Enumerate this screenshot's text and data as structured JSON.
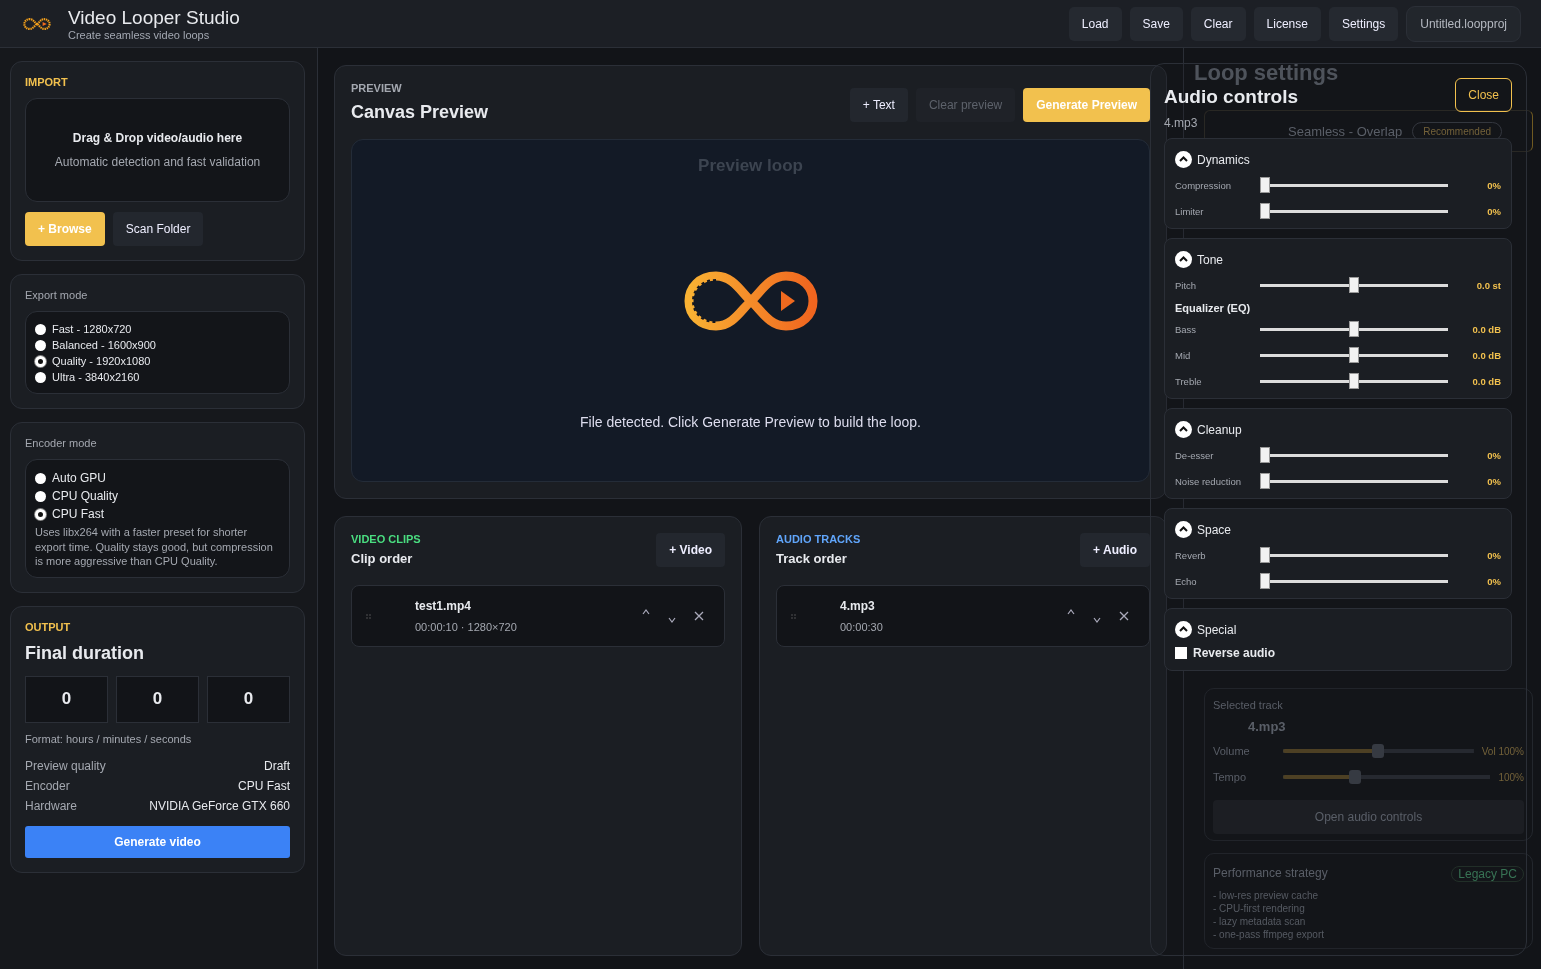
{
  "app": {
    "title": "Video Looper Studio",
    "subtitle": "Create seamless video loops"
  },
  "toolbar": [
    {
      "label": "Load"
    },
    {
      "label": "Save"
    },
    {
      "label": "Clear"
    },
    {
      "label": "License"
    },
    {
      "label": "Settings"
    }
  ],
  "project_file": "Untitled.loopproj",
  "import": {
    "heading": "IMPORT",
    "drop_title": "Drag & Drop video/audio here",
    "drop_hint": "Automatic detection and fast validation",
    "buttons": [
      {
        "label": "+ Browse",
        "kind": "primary"
      },
      {
        "label": "Scan Folder",
        "kind": "secondary"
      }
    ]
  },
  "export_mode": {
    "heading": "Export mode",
    "options": [
      {
        "label": "Fast - 1280x720",
        "selected": false
      },
      {
        "label": "Balanced - 1600x900",
        "selected": false
      },
      {
        "label": "Quality - 1920x1080",
        "selected": true
      },
      {
        "label": "Ultra - 3840x2160",
        "selected": false
      }
    ]
  },
  "encoder_mode": {
    "heading": "Encoder mode",
    "options": [
      {
        "label": "Auto GPU",
        "selected": false
      },
      {
        "label": "CPU Quality",
        "selected": false
      },
      {
        "label": "CPU Fast",
        "selected": true
      }
    ],
    "description": "Uses libx264 with a faster preset for shorter export time. Quality stays good, but compression is more aggressive than CPU Quality."
  },
  "output": {
    "heading": "OUTPUT",
    "title": "Final duration",
    "fields": [
      "0",
      "0",
      "0"
    ],
    "format_hint": "Format: hours / minutes / seconds",
    "info": [
      {
        "label": "Preview quality",
        "value": "Draft"
      },
      {
        "label": "Encoder",
        "value": "CPU Fast"
      },
      {
        "label": "Hardware",
        "value": "NVIDIA GeForce GTX 660"
      }
    ],
    "button": "Generate video"
  },
  "preview": {
    "eyebrow": "PREVIEW",
    "title": "Canvas Preview",
    "buttons": [
      {
        "label": "+ Text",
        "kind": "secondary"
      },
      {
        "label": "Clear preview",
        "kind": "disabled"
      },
      {
        "label": "Generate Preview",
        "kind": "primary"
      }
    ],
    "canvas_title": "Preview loop",
    "message": "File detected. Click Generate Preview to build the loop."
  },
  "video_clips": {
    "eyebrow": "VIDEO CLIPS",
    "title": "Clip order",
    "add_button": "+ Video",
    "items": [
      {
        "name": "test1.mp4",
        "meta": "00:00:10 · 1280×720"
      }
    ]
  },
  "audio_tracks": {
    "eyebrow": "AUDIO TRACKS",
    "title": "Track order",
    "add_button": "+ Audio",
    "items": [
      {
        "name": "4.mp3",
        "meta": "00:00:30"
      }
    ]
  },
  "loop_settings": {
    "title": "Loop settings",
    "option": {
      "label": "Seamless - Overlap",
      "badge": "Recommended"
    },
    "selected_track_label": "Selected track",
    "selected_track": "4.mp3",
    "sliders": [
      {
        "label": "Volume",
        "level": 0.5,
        "reading": "Vol 100%"
      },
      {
        "label": "Tempo",
        "level": 0.34,
        "reading": "100%"
      }
    ],
    "open_button": "Open audio controls",
    "performance": {
      "title": "Performance strategy",
      "badge": "Legacy PC",
      "items": [
        "- low-res preview cache",
        "- CPU-first rendering",
        "- lazy metadata scan",
        "- one-pass ffmpeg export"
      ]
    }
  },
  "audio_controls": {
    "title": "Audio controls",
    "close": "Close",
    "track": "4.mp3",
    "sections": [
      {
        "title": "Dynamics",
        "expanded": true,
        "rows": [
          {
            "kind": "slider",
            "label": "Compression",
            "level": 0,
            "reading": "0%"
          },
          {
            "kind": "slider",
            "label": "Limiter",
            "level": 0,
            "reading": "0%"
          }
        ]
      },
      {
        "title": "Tone",
        "expanded": true,
        "rows": [
          {
            "kind": "slider",
            "label": "Pitch",
            "level": 0.5,
            "reading": "0.0 st"
          },
          {
            "kind": "subheading",
            "label": "Equalizer (EQ)"
          },
          {
            "kind": "slider",
            "label": "Bass",
            "level": 0.5,
            "reading": "0.0 dB"
          },
          {
            "kind": "slider",
            "label": "Mid",
            "level": 0.5,
            "reading": "0.0 dB"
          },
          {
            "kind": "slider",
            "label": "Treble",
            "level": 0.5,
            "reading": "0.0 dB"
          }
        ]
      },
      {
        "title": "Cleanup",
        "expanded": true,
        "rows": [
          {
            "kind": "slider",
            "label": "De-esser",
            "level": 0,
            "reading": "0%"
          },
          {
            "kind": "slider",
            "label": "Noise reduction",
            "level": 0,
            "reading": "0%"
          }
        ]
      },
      {
        "title": "Space",
        "expanded": true,
        "rows": [
          {
            "kind": "slider",
            "label": "Reverb",
            "level": 0,
            "reading": "0%"
          },
          {
            "kind": "slider",
            "label": "Echo",
            "level": 0,
            "reading": "0%"
          }
        ]
      },
      {
        "title": "Special",
        "expanded": true,
        "rows": [
          {
            "kind": "checkbox",
            "label": "Reverse audio",
            "checked": false
          }
        ]
      }
    ]
  }
}
